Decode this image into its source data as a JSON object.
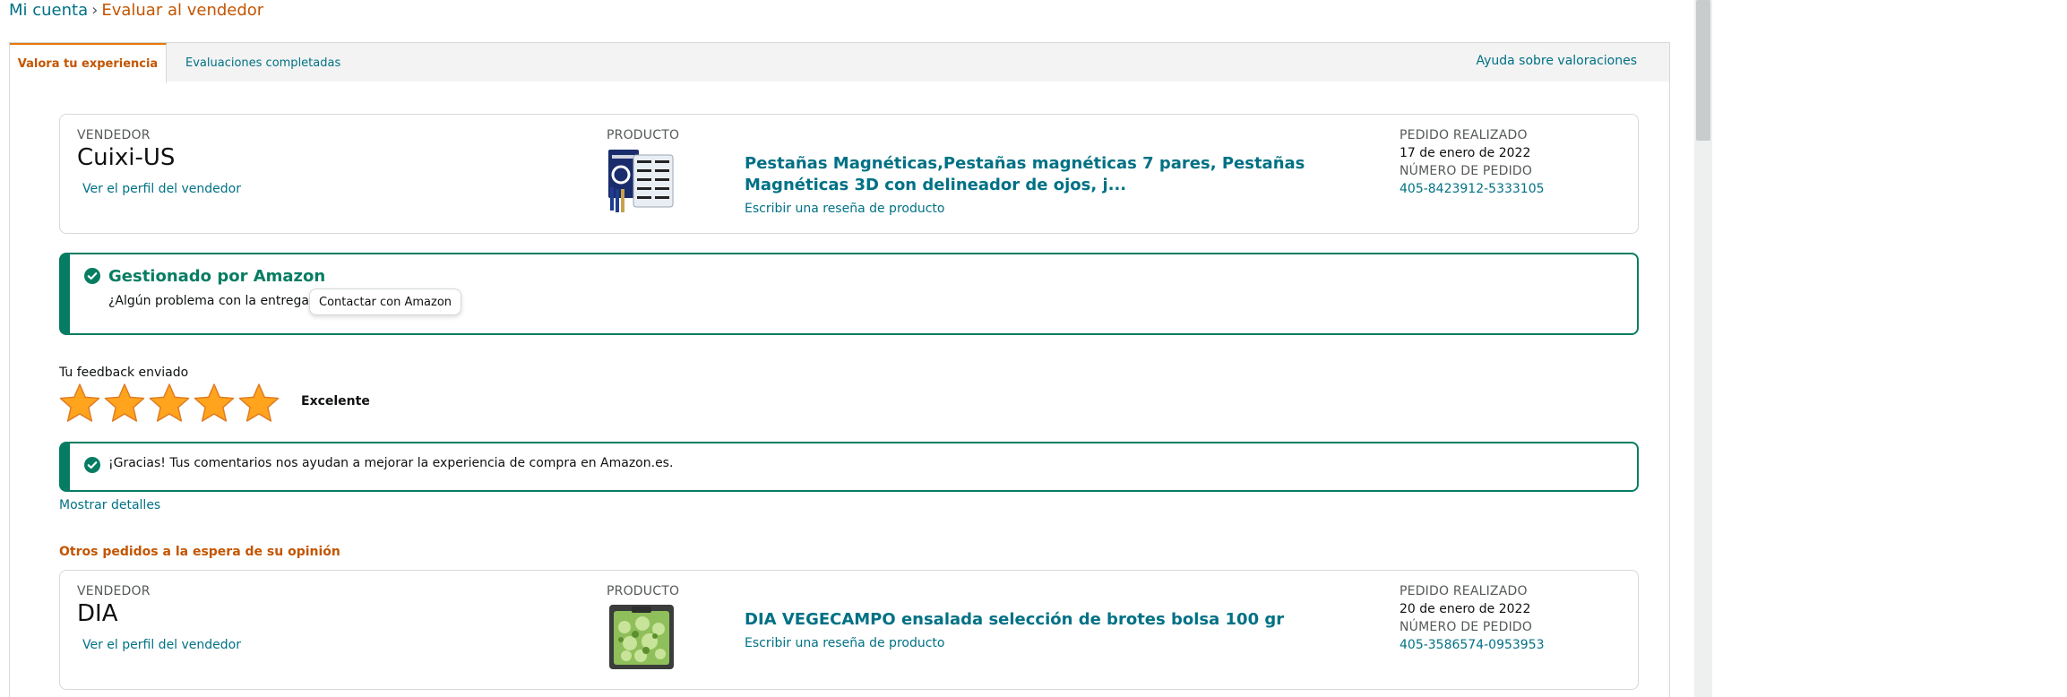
{
  "breadcrumb": {
    "account": "Mi cuenta",
    "separator": "›",
    "current": "Evaluar al vendedor"
  },
  "tabs": {
    "active": "Valora tu experiencia",
    "completed": "Evaluaciones completadas",
    "help": "Ayuda sobre valoraciones"
  },
  "order1": {
    "seller_label": "VENDEDOR",
    "seller_name": "Cuixi-US",
    "seller_profile_link": "Ver el perfil del vendedor",
    "product_label": "PRODUCTO",
    "product_title": "Pestañas Magnéticas,Pestañas magnéticas 7 pares, Pestañas Magnéticas 3D con delineador de ojos, j...",
    "product_review_link": "Escribir una reseña de producto",
    "order_placed_label": "PEDIDO REALIZADO",
    "order_date": "17 de enero de 2022",
    "order_number_label": "NÚMERO DE PEDIDO",
    "order_number": "405-8423912-5333105"
  },
  "managed": {
    "title": "Gestionado por Amazon",
    "question": "¿Algún problema con la entrega?",
    "contact_button": "Contactar con Amazon"
  },
  "feedback": {
    "label": "Tu feedback enviado",
    "rating": 5,
    "rating_max": 5,
    "rating_text": "Excelente"
  },
  "thanks": {
    "message": "¡Gracias! Tus comentarios nos ayudan a mejorar la experiencia de compra en Amazon.es."
  },
  "show_details": "Mostrar detalles",
  "other_orders_heading": "Otros pedidos a la espera de su opinión",
  "order2": {
    "seller_label": "VENDEDOR",
    "seller_name": "DIA",
    "seller_profile_link": "Ver el perfil del vendedor",
    "product_label": "PRODUCTO",
    "product_title": "DIA VEGECAMPO ensalada selección de brotes bolsa 100 gr",
    "product_review_link": "Escribir una reseña de producto",
    "order_placed_label": "PEDIDO REALIZADO",
    "order_date": "20 de enero de 2022",
    "order_number_label": "NÚMERO DE PEDIDO",
    "order_number": "405-3586574-0953953"
  },
  "colors": {
    "link": "#007185",
    "accent_orange": "#c45500",
    "success_green": "#067d62",
    "star_gold": "#ffa41c"
  },
  "icons": {
    "check": "check-circle-icon",
    "star": "star-icon"
  }
}
